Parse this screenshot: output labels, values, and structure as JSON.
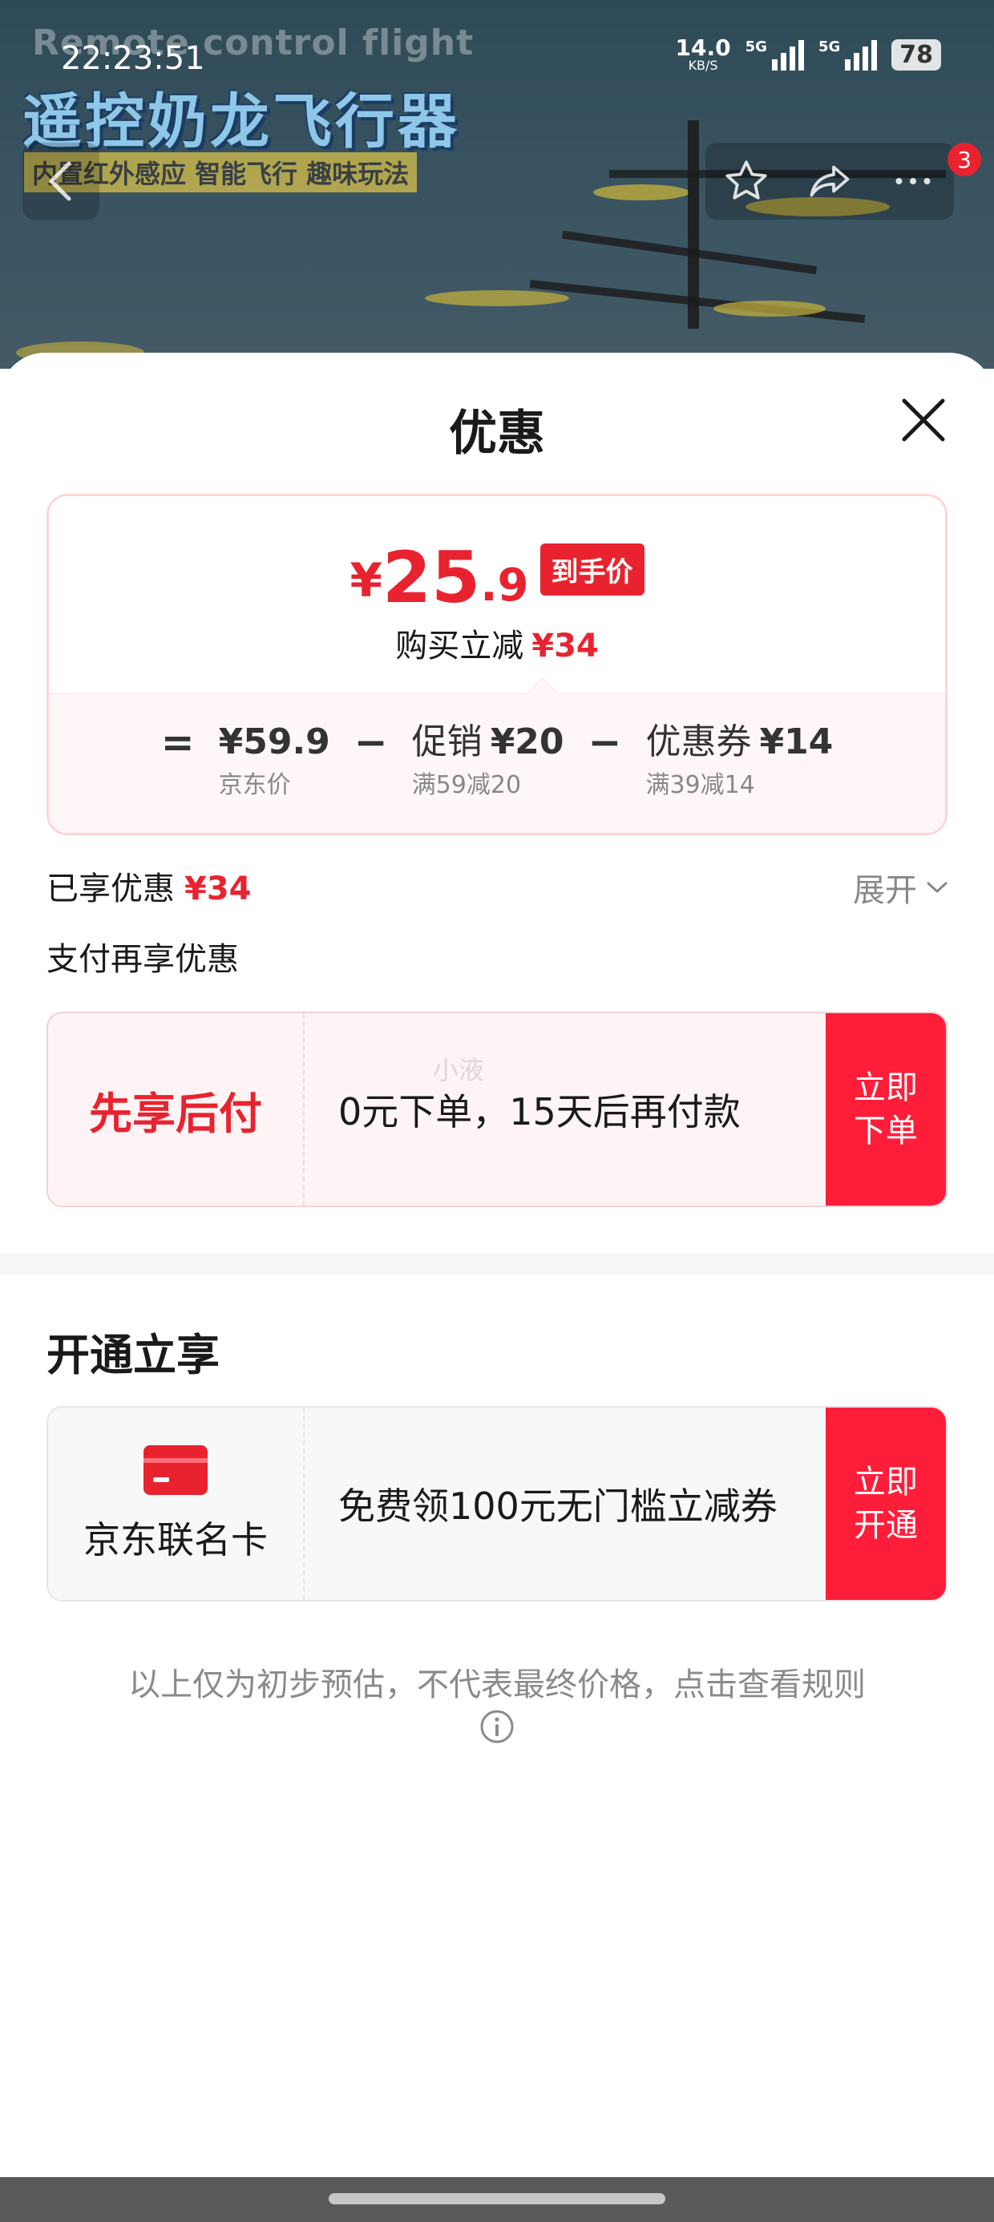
{
  "status_bar": {
    "time": "22:23:51",
    "net_speed": "14.0",
    "net_unit": "KB/S",
    "sim1": "5G",
    "sim2": "5G",
    "battery": "78"
  },
  "banner": {
    "english_title": "Remote control flight",
    "title": "遥控奶龙飞行器",
    "subtitle": "内置红外感应 智能飞行  趣味玩法",
    "cart_badge": "3"
  },
  "sheet": {
    "title": "优惠"
  },
  "price_card": {
    "currency": "¥",
    "final_int": "25",
    "final_dec": ".9",
    "final_tag": "到手价",
    "saved_label": "购买立减",
    "saved_amount": "¥34",
    "equals": "=",
    "minus": "−",
    "terms": [
      {
        "label": "",
        "value": "¥59.9",
        "sub": "京东价"
      },
      {
        "label": "促销",
        "value": "¥20",
        "sub": "满59减20"
      },
      {
        "label": "优惠券",
        "value": "¥14",
        "sub": "满39减14"
      }
    ]
  },
  "enjoyed": {
    "label": "已享优惠",
    "amount": "¥34",
    "expand_label": "展开"
  },
  "pay_section": {
    "title": "支付再享优惠",
    "watermark": "小液",
    "offer_name": "先享后付",
    "offer_desc": "0元下单，15天后再付款",
    "button": "立即\n下单"
  },
  "card_section": {
    "title": "开通立享",
    "card_name": "京东联名卡",
    "offer_desc": "免费领100元无门槛立减券",
    "button": "立即\n开通"
  },
  "disclaimer": "以上仅为初步预估，不代表最终价格，点击查看规则",
  "colors": {
    "accent_red": "#e8232f",
    "button_red": "#fe1e3a",
    "card_pink_bg": "#fff4f5"
  }
}
